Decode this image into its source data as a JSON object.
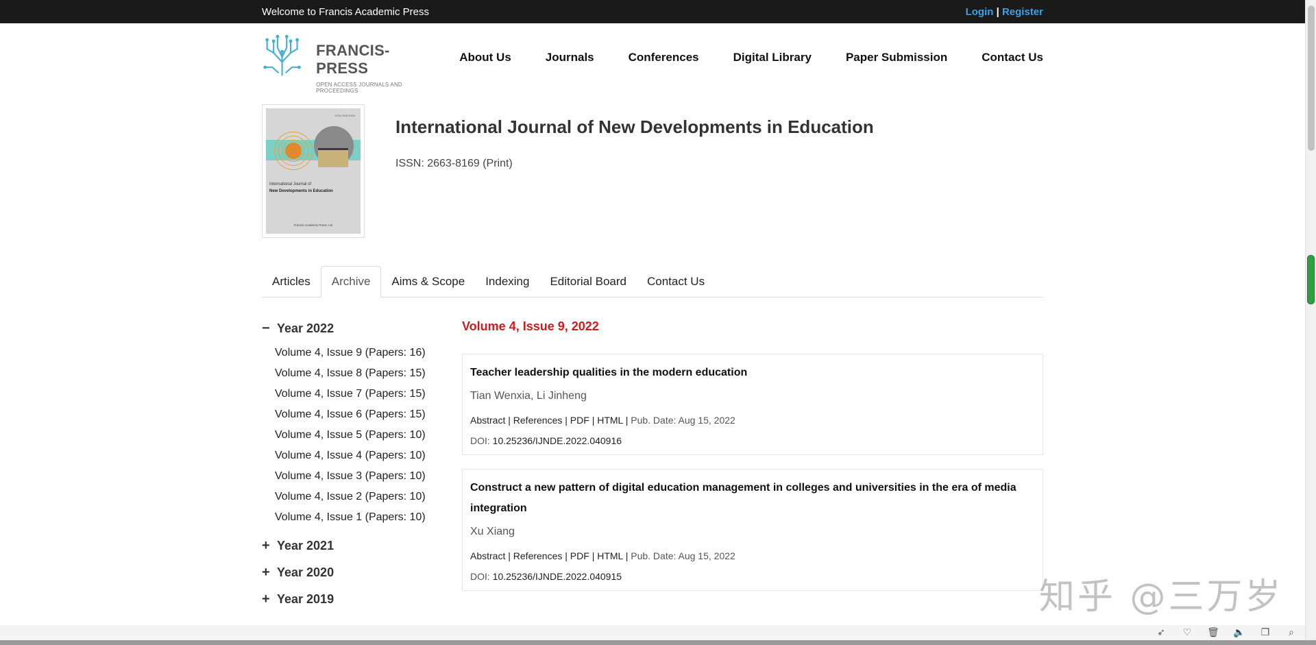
{
  "topbar": {
    "welcome": "Welcome to Francis Academic Press",
    "login": "Login",
    "separator": "|",
    "register": "Register"
  },
  "logo": {
    "name": "FRANCIS-PRESS",
    "tagline": "OPEN ACCESS JOURNALS AND PROCEEDINGS"
  },
  "nav": {
    "items": [
      "About Us",
      "Journals",
      "Conferences",
      "Digital Library",
      "Paper Submission",
      "Contact Us"
    ]
  },
  "journal": {
    "title": "International Journal of New Developments in Education",
    "issn": "ISSN: 2663-8169 (Print)",
    "cover": {
      "issn": "ISSN 2663-8169",
      "line1": "International Journal of",
      "line2": "New Developments in Education",
      "publisher": "Francis Academic Press, UK"
    }
  },
  "tabs": {
    "items": [
      "Articles",
      "Archive",
      "Aims & Scope",
      "Indexing",
      "Editorial Board",
      "Contact Us"
    ],
    "active": "Archive"
  },
  "sidebar": {
    "expanded_year": "Year 2022",
    "expanded_sign": "−",
    "collapsed_sign": "+",
    "issues": [
      "Volume 4, Issue 9 (Papers: 16)",
      "Volume 4, Issue 8 (Papers: 15)",
      "Volume 4, Issue 7 (Papers: 15)",
      "Volume 4, Issue 6 (Papers: 15)",
      "Volume 4, Issue 5 (Papers: 10)",
      "Volume 4, Issue 4 (Papers: 10)",
      "Volume 4, Issue 3 (Papers: 10)",
      "Volume 4, Issue 2 (Papers: 10)",
      "Volume 4, Issue 1 (Papers: 10)"
    ],
    "other_years": [
      "Year 2021",
      "Year 2020",
      "Year 2019"
    ]
  },
  "main": {
    "issue_title": "Volume 4, Issue 9, 2022",
    "links_sep": "|",
    "papers": [
      {
        "title": "Teacher leadership qualities in the modern education",
        "authors": "Tian Wenxia, Li Jinheng",
        "abstract": "Abstract",
        "references": "References",
        "pdf": "PDF",
        "html": "HTML",
        "date": "Pub. Date: Aug 15, 2022",
        "doi_label": "DOI:",
        "doi": "10.25236/IJNDE.2022.040916"
      },
      {
        "title": "Construct a new pattern of digital education management in colleges and universities in the era of media integration",
        "authors": "Xu Xiang",
        "abstract": "Abstract",
        "references": "References",
        "pdf": "PDF",
        "html": "HTML",
        "date": "Pub. Date: Aug 15, 2022",
        "doi_label": "DOI:",
        "doi": "10.25236/IJNDE.2022.040915"
      }
    ]
  },
  "watermark": "知乎 @三万岁",
  "colors": {
    "topbar_bg": "#1a1a1a",
    "link_blue": "#3aa2e8",
    "issue_red": "#c81e1e"
  },
  "status_icons": [
    "rocket-icon",
    "heart-icon",
    "trash-icon",
    "speaker-icon",
    "window-icon",
    "search-icon"
  ]
}
